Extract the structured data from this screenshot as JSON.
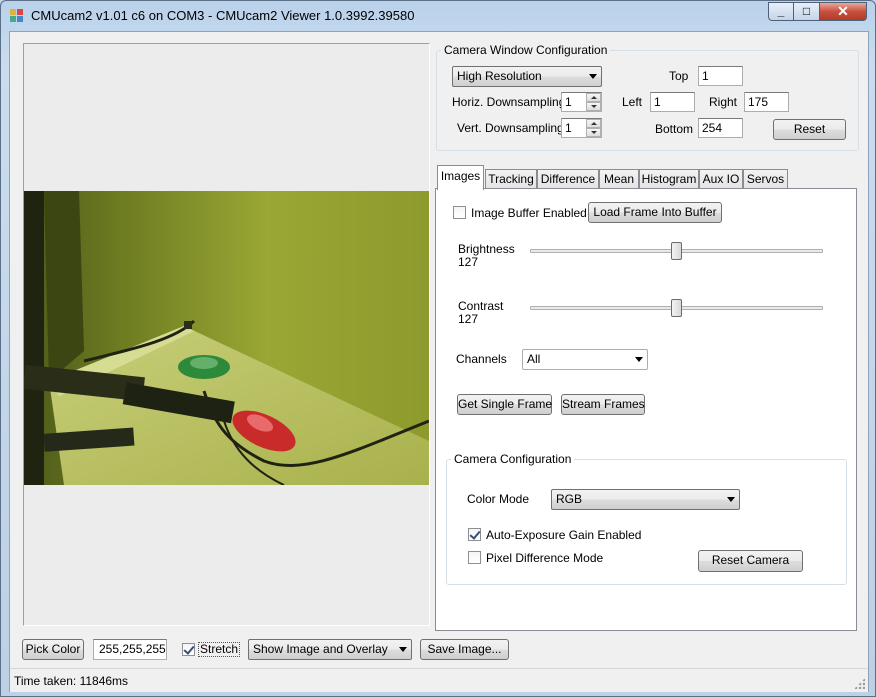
{
  "window": {
    "title": "CMUcam2 v1.01 c6 on COM3 - CMUcam2 Viewer 1.0.3992.39580",
    "minimize_glyph": "_",
    "maximize_glyph": "□",
    "close_glyph": "✕"
  },
  "camera_window_config": {
    "title": "Camera Window Configuration",
    "resolution": "High Resolution",
    "horiz_label": "Horiz. Downsampling",
    "horiz_value": "1",
    "vert_label": "Vert. Downsampling",
    "vert_value": "1",
    "top_label": "Top",
    "top_value": "1",
    "left_label": "Left",
    "left_value": "1",
    "right_label": "Right",
    "right_value": "175",
    "bottom_label": "Bottom",
    "bottom_value": "254",
    "reset_label": "Reset"
  },
  "tabs": [
    "Images",
    "Tracking",
    "Difference",
    "Mean",
    "Histogram",
    "Aux IO",
    "Servos"
  ],
  "active_tab": "Images",
  "images_tab": {
    "buffer_enabled_label": "Image Buffer Enabled",
    "buffer_enabled_checked": false,
    "load_frame_label": "Load Frame Into Buffer",
    "brightness_label": "Brightness",
    "brightness_value": "127",
    "brightness_fraction": 0.5,
    "contrast_label": "Contrast",
    "contrast_value": "127",
    "contrast_fraction": 0.5,
    "channels_label": "Channels",
    "channels_value": "All",
    "get_single_frame_label": "Get Single Frame",
    "stream_frames_label": "Stream Frames"
  },
  "camera_config": {
    "title": "Camera Configuration",
    "color_mode_label": "Color Mode",
    "color_mode_value": "RGB",
    "auto_exposure_label": "Auto-Exposure Gain Enabled",
    "auto_exposure_checked": true,
    "pixel_diff_label": "Pixel Difference Mode",
    "pixel_diff_checked": false,
    "reset_camera_label": "Reset Camera"
  },
  "bottom_bar": {
    "pick_color_label": "Pick Color",
    "color_value": "255,255,255",
    "stretch_label": "Stretch",
    "stretch_checked": true,
    "display_mode": "Show Image and Overlay",
    "save_image_label": "Save Image..."
  },
  "status": {
    "text": "Time taken: 11846ms"
  },
  "colors": {
    "image_tint": "#9aa734",
    "accent": "#3d6bb0"
  }
}
